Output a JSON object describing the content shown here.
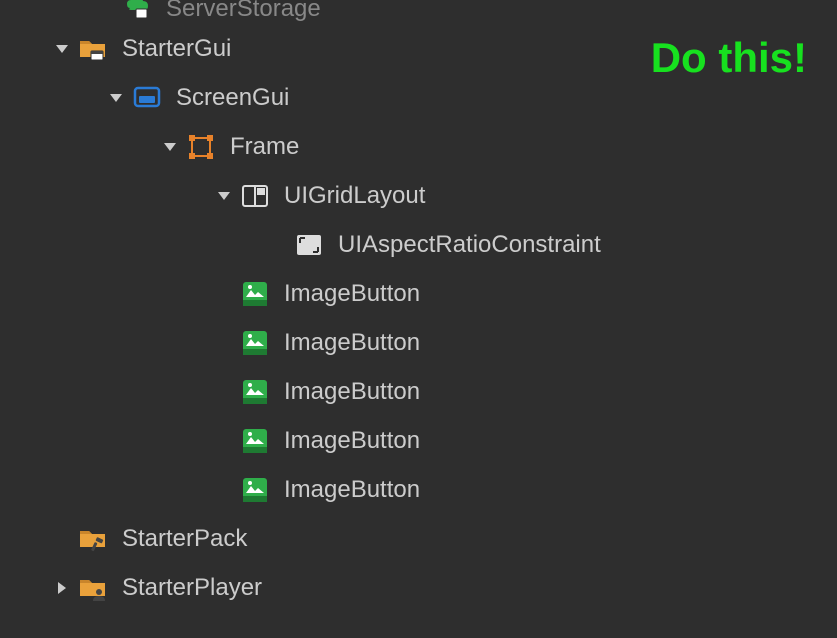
{
  "annotation": "Do this!",
  "tree": {
    "serverStorage": "ServerStorage",
    "starterGui": "StarterGui",
    "screenGui": "ScreenGui",
    "frame": "Frame",
    "uiGridLayout": "UIGridLayout",
    "uiAspectRatioConstraint": "UIAspectRatioConstraint",
    "imageButton1": "ImageButton",
    "imageButton2": "ImageButton",
    "imageButton3": "ImageButton",
    "imageButton4": "ImageButton",
    "imageButton5": "ImageButton",
    "starterPack": "StarterPack",
    "starterPlayer": "StarterPlayer"
  }
}
